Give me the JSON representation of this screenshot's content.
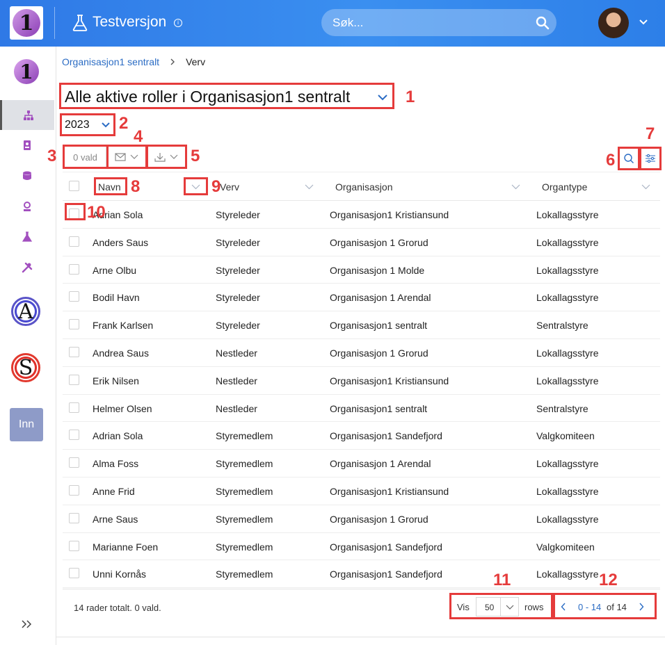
{
  "header": {
    "env_title": "Testversjon",
    "search_placeholder": "Søk...",
    "colors": {
      "primary": "#2f79e6"
    }
  },
  "sidebar": {
    "inn_label": "Inn",
    "items": [
      "org-structure-icon",
      "contact-card-icon",
      "database-icon",
      "badge-icon",
      "flask-icon",
      "tools-icon"
    ],
    "apps": [
      "A",
      "S"
    ]
  },
  "breadcrumb": {
    "parent": "Organisasjon1 sentralt",
    "current": "Verv"
  },
  "role_select": {
    "value": "Alle aktive roller i Organisasjon1 sentralt"
  },
  "year_select": {
    "value": "2023"
  },
  "toolbar": {
    "selected_label": "0 vald"
  },
  "table": {
    "columns": [
      "Navn",
      "Verv",
      "Organisasjon",
      "Organtype"
    ],
    "rows": [
      {
        "navn": "Adrian Sola",
        "verv": "Styreleder",
        "org": "Organisasjon1 Kristiansund",
        "type": "Lokallagsstyre"
      },
      {
        "navn": "Anders Saus",
        "verv": "Styreleder",
        "org": "Organisasjon 1 Grorud",
        "type": "Lokallagsstyre"
      },
      {
        "navn": "Arne Olbu",
        "verv": "Styreleder",
        "org": "Organisasjon 1 Molde",
        "type": "Lokallagsstyre"
      },
      {
        "navn": "Bodil Havn",
        "verv": "Styreleder",
        "org": "Organisasjon 1 Arendal",
        "type": "Lokallagsstyre"
      },
      {
        "navn": "Frank Karlsen",
        "verv": "Styreleder",
        "org": "Organisasjon1 sentralt",
        "type": "Sentralstyre"
      },
      {
        "navn": "Andrea Saus",
        "verv": "Nestleder",
        "org": "Organisasjon 1 Grorud",
        "type": "Lokallagsstyre"
      },
      {
        "navn": "Erik Nilsen",
        "verv": "Nestleder",
        "org": "Organisasjon1 Kristiansund",
        "type": "Lokallagsstyre"
      },
      {
        "navn": "Helmer Olsen",
        "verv": "Nestleder",
        "org": "Organisasjon1 sentralt",
        "type": "Sentralstyre"
      },
      {
        "navn": "Adrian Sola",
        "verv": "Styremedlem",
        "org": "Organisasjon1 Sandefjord",
        "type": "Valgkomiteen"
      },
      {
        "navn": "Alma Foss",
        "verv": "Styremedlem",
        "org": "Organisasjon 1 Arendal",
        "type": "Lokallagsstyre"
      },
      {
        "navn": "Anne Frid",
        "verv": "Styremedlem",
        "org": "Organisasjon1 Kristiansund",
        "type": "Lokallagsstyre"
      },
      {
        "navn": "Arne Saus",
        "verv": "Styremedlem",
        "org": "Organisasjon 1 Grorud",
        "type": "Lokallagsstyre"
      },
      {
        "navn": "Marianne Foen",
        "verv": "Styremedlem",
        "org": "Organisasjon1 Sandefjord",
        "type": "Valgkomiteen"
      },
      {
        "navn": "Unni Kornås",
        "verv": "Styremedlem",
        "org": "Organisasjon1 Sandefjord",
        "type": "Lokallagsstyre"
      }
    ]
  },
  "footer": {
    "total_text": "14 rader totalt. 0 vald.",
    "vis_label": "Vis",
    "rows_per_page": "50",
    "rows_label": "rows",
    "range": "0 - 14",
    "of_text": "of 14"
  },
  "annotations": {
    "color": "#e53b3b",
    "labels": [
      "1",
      "2",
      "3",
      "4",
      "5",
      "6",
      "7",
      "8",
      "9",
      "10",
      "11",
      "12"
    ]
  }
}
